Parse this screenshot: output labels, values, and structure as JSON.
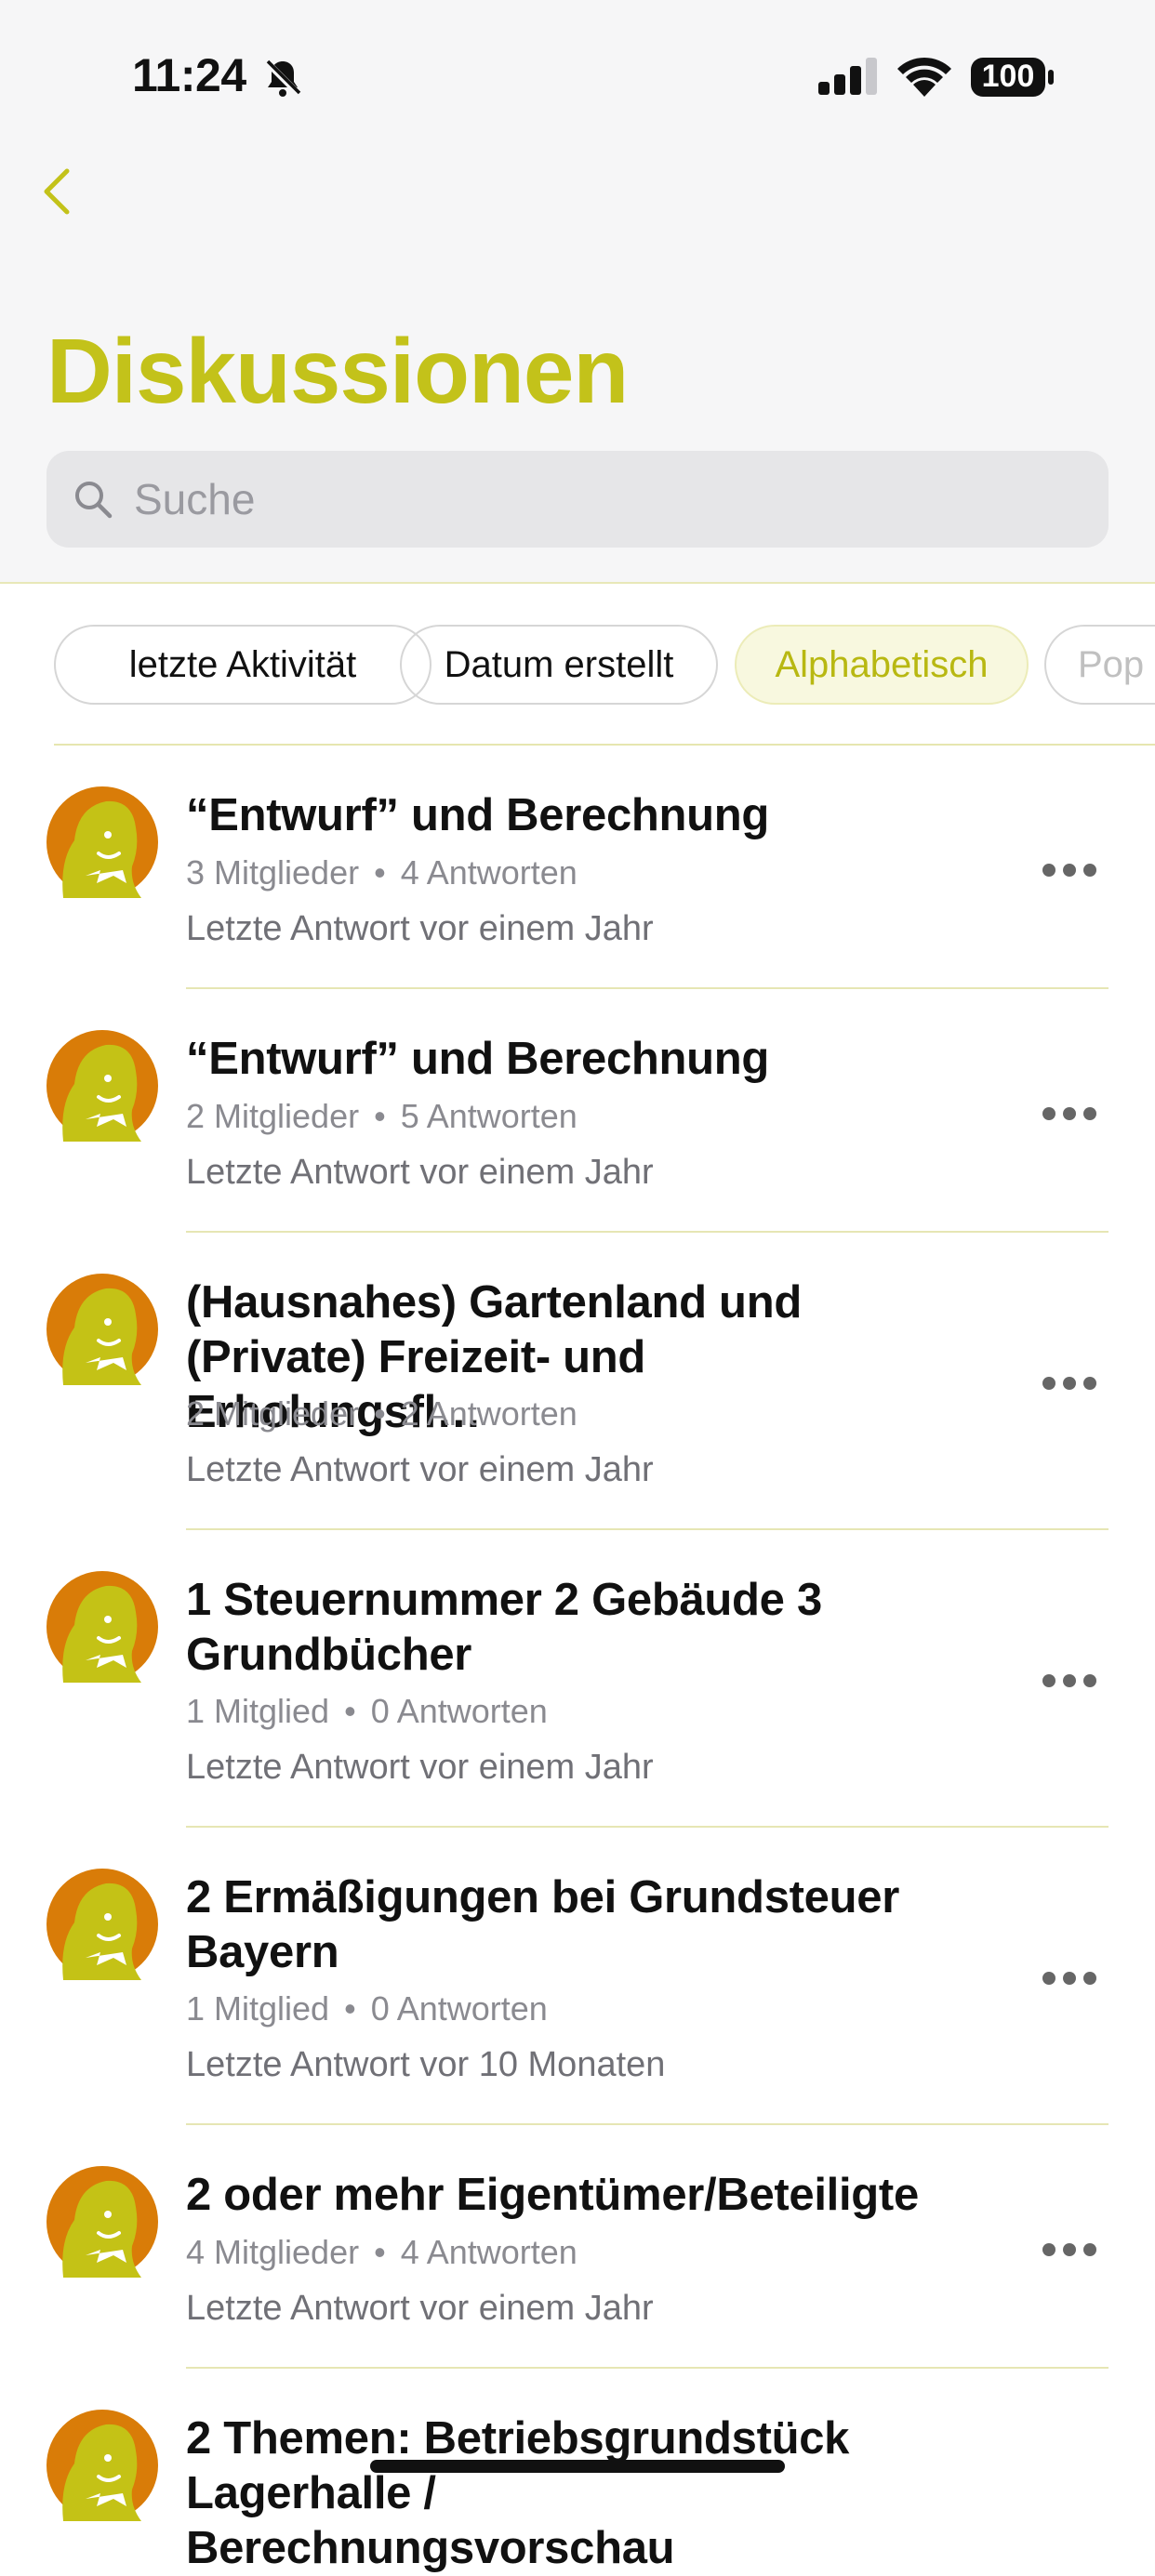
{
  "status_bar": {
    "time": "11:24",
    "battery": "100"
  },
  "header": {
    "title": "Diskussionen",
    "search_placeholder": "Suche"
  },
  "sort_chips": [
    {
      "label": "letzte Aktivität",
      "active": false
    },
    {
      "label": "Datum erstellt",
      "active": false
    },
    {
      "label": "Alphabetisch",
      "active": true
    },
    {
      "label": "Pop",
      "active": false
    }
  ],
  "discussions": [
    {
      "title": "“Entwurf” und Berechnung",
      "members": "3 Mitglieder",
      "answers": "4 Antworten",
      "last": "Letzte Antwort vor einem Jahr"
    },
    {
      "title": "“Entwurf” und Berechnung",
      "members": "2 Mitglieder",
      "answers": "5 Antworten",
      "last": "Letzte Antwort vor einem Jahr"
    },
    {
      "title_line1": "(Hausnahes) Gartenland und",
      "title_line2": "(Private) Freizeit- und Erholungsfl…",
      "members": "2 Mitglieder",
      "answers": "2 Antworten",
      "last": "Letzte Antwort vor einem Jahr"
    },
    {
      "title_line1": "1 Steuernummer 2 Gebäude 3",
      "title_line2": "Grundbücher",
      "members": "1 Mitglied",
      "answers": "0 Antworten",
      "last": "Letzte Antwort vor einem Jahr"
    },
    {
      "title_line1": "2 Ermäßigungen bei Grundsteuer",
      "title_line2": "Bayern",
      "members": "1 Mitglied",
      "answers": "0 Antworten",
      "last": "Letzte Antwort vor 10 Monaten"
    },
    {
      "title": "2 oder mehr Eigentümer/Beteiligte",
      "members": "4 Mitglieder",
      "answers": "4 Antworten",
      "last": "Letzte Antwort vor einem Jahr"
    },
    {
      "title_line1": "2 Themen: Betriebsgrundstück",
      "title_line2": "Lagerhalle / Berechnungsvorschau"
    }
  ],
  "colors": {
    "accent": "#c3c21a",
    "avatar_bg": "#d97c08",
    "avatar_face": "#c4c216",
    "divider": "#e6e6b4"
  }
}
